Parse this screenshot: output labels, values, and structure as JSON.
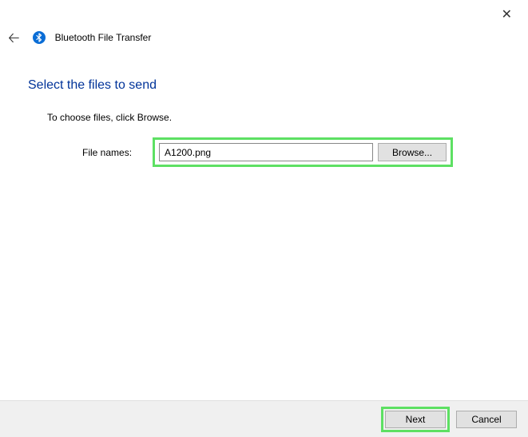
{
  "window": {
    "title": "Bluetooth File Transfer"
  },
  "main": {
    "heading": "Select the files to send",
    "instruction": "To choose files, click Browse.",
    "fileLabel": "File names:",
    "fileValue": "A1200.png",
    "browseLabel": "Browse..."
  },
  "footer": {
    "nextLabel": "Next",
    "cancelLabel": "Cancel"
  }
}
